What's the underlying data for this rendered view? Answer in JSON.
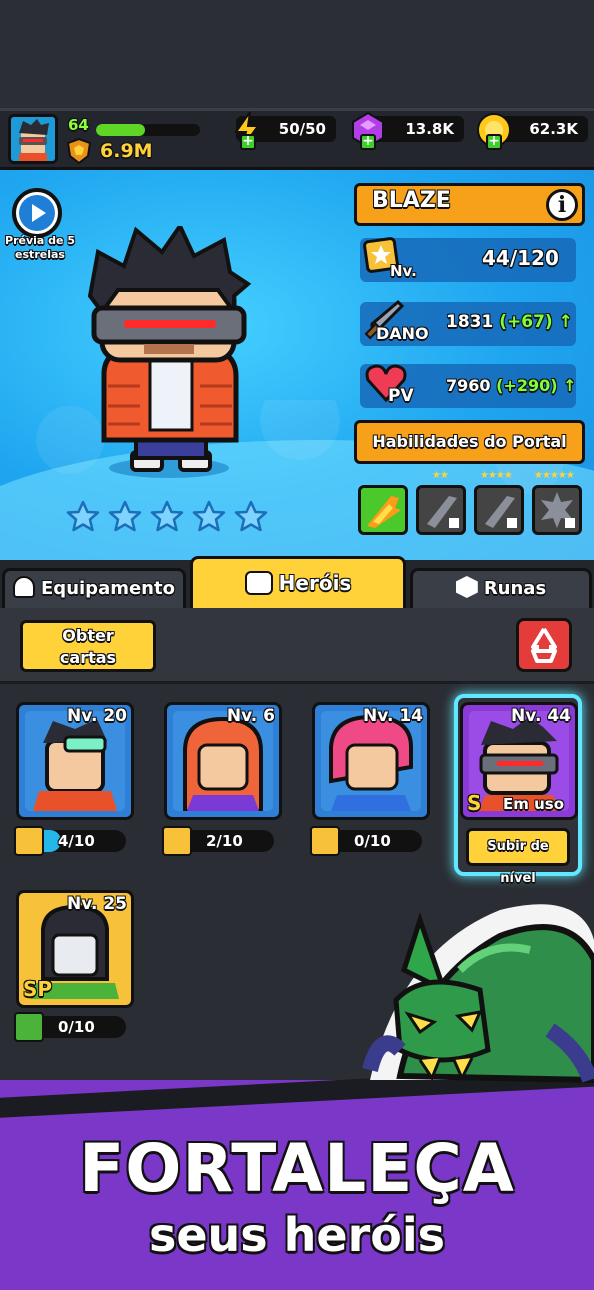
{
  "player": {
    "level": "64",
    "xp_fraction": 0.47,
    "power": "6.9M"
  },
  "resources": {
    "energy": "50/50",
    "gems": "13.8K",
    "coins": "62.3K"
  },
  "preview": {
    "label": "Prévia de 5 estrelas"
  },
  "hero": {
    "name": "BLAZE",
    "level_label": "Nv.",
    "level_value": "44/120",
    "damage_label": "DANO",
    "damage_value": "1831",
    "damage_bonus": "(+67)",
    "hp_label": "PV",
    "hp_value": "7960",
    "hp_bonus": "(+290)",
    "stars_filled": 0,
    "stars_total": 5,
    "portal_button": "Habilidades do Portal",
    "skills": [
      {
        "stars": "",
        "locked": false
      },
      {
        "stars": "★★",
        "locked": true
      },
      {
        "stars": "★★★★",
        "locked": true
      },
      {
        "stars": "★★★★★",
        "locked": true
      }
    ]
  },
  "tabs": [
    {
      "label": "Equipamento",
      "active": false
    },
    {
      "label": "Heróis",
      "active": true
    },
    {
      "label": "Runas",
      "active": false
    }
  ],
  "toolbar": {
    "obter_line1": "Obter",
    "obter_line2": "cartas"
  },
  "cards": [
    {
      "level": "Nv. 20",
      "count": "4/10",
      "progress": 0.4
    },
    {
      "level": "Nv. 6",
      "count": "2/10",
      "progress": 0.2
    },
    {
      "level": "Nv. 14",
      "count": "0/10",
      "progress": 0
    },
    {
      "level": "Nv. 44",
      "badge": "S",
      "status": "Em uso",
      "button": "Subir de nível"
    },
    {
      "level": "Nv. 25",
      "badge": "SP",
      "count": "0/10",
      "progress": 0
    }
  ],
  "banner": {
    "title": "FORTALEÇA",
    "subtitle": "seus heróis"
  },
  "colors": {
    "accent": "#ffd23a",
    "orange": "#f7a01a",
    "sky": "#1fa6f0",
    "purple": "#7a37c8",
    "selected": "#5fe8ff"
  }
}
